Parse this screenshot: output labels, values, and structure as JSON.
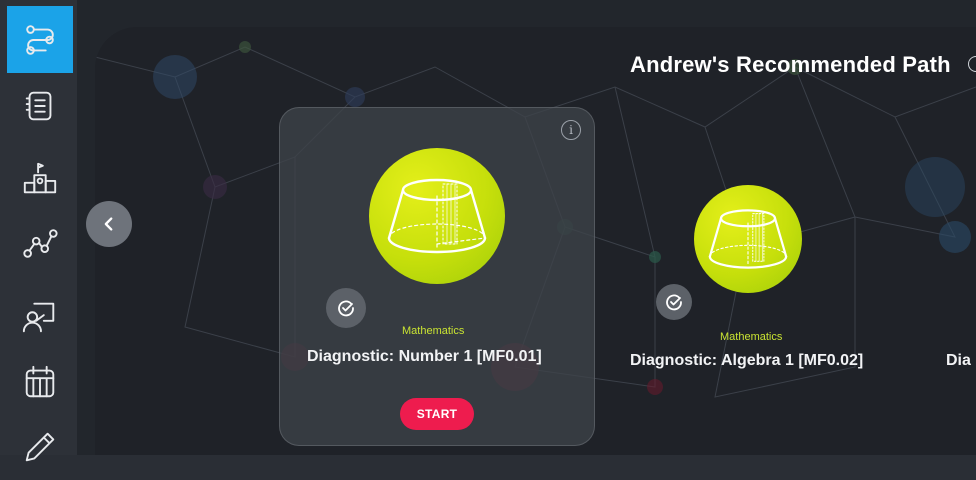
{
  "sidebar": {
    "items": [
      {
        "icon": "learning-path-icon",
        "active": true
      },
      {
        "icon": "list-notebook-icon",
        "active": false
      },
      {
        "icon": "leaderboard-podium-icon",
        "active": false
      },
      {
        "icon": "progress-graph-icon",
        "active": false
      },
      {
        "icon": "teacher-board-icon",
        "active": false
      },
      {
        "icon": "calendar-icon",
        "active": false
      },
      {
        "icon": "pencil-icon",
        "active": false
      }
    ],
    "active_color": "#1ba3e8"
  },
  "main": {
    "heading": "Andrew's Recommended Path",
    "cards": [
      {
        "subject": "Mathematics",
        "title": "Diagnostic: Number 1 [MF0.01]",
        "start_label": "START",
        "icon": "cone-shape-icon",
        "completed_badge": "check-circle-icon"
      },
      {
        "subject": "Mathematics",
        "title": "Diagnostic: Algebra 1 [MF0.02]",
        "icon": "cone-shape-icon",
        "completed_badge": "check-circle-icon"
      },
      {
        "title_partial": "Dia"
      }
    ]
  },
  "colors": {
    "accent": "#1ba3e8",
    "start_button": "#ee1c4e",
    "subject_text": "#c9e332",
    "course_icon": "#d4e515"
  }
}
